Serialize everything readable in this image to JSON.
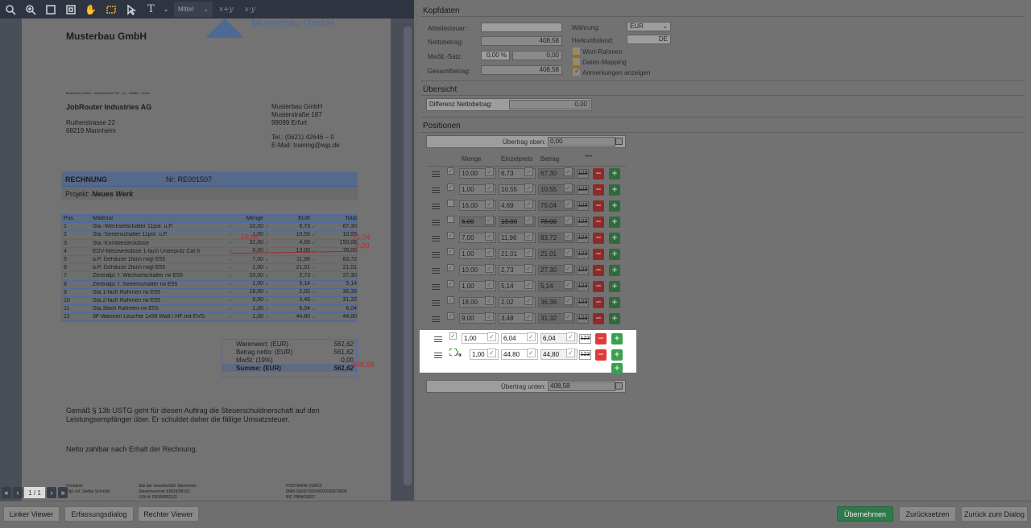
{
  "toolbar": {
    "zoom_label": "Mittel",
    "xy1": "x+y",
    "xy2": "x·y"
  },
  "pager": {
    "page": "1 / 1"
  },
  "invoice": {
    "header_company": "Musterbau GmbH",
    "logo_text": "Musterbau GmbH",
    "sender_line": "Musterbau GmbH - Musterstraße 187 – D – 99089 – Erfurt",
    "recipient": [
      "JobRouter Industries AG",
      "",
      "Rutherstrasse 22",
      "68219 Mannheim"
    ],
    "sender": [
      "Musterbau GmbH",
      "Musterstraße 187",
      "99089 Erfurt",
      "",
      "Tel.: (0621) 42646 – 0",
      "E-Mail: training@wjp.de"
    ],
    "rechnung_label": "RECHNUNG",
    "rechnung_nr": "Nr: RE001507",
    "projekt_label": "Projekt:",
    "projekt_value": "Neues Werk",
    "cols": [
      "Pos",
      "Material",
      "Menge",
      "EUR",
      "Total"
    ],
    "rows": [
      [
        "1",
        "Sta.-Wechselschalter 11pol. u.P.",
        "10,00",
        "6,73",
        "67,30"
      ],
      [
        "2",
        "Sta.-Serienschalter 11pol. u.P.",
        "1,00",
        "10,55",
        "10,55"
      ],
      [
        "3",
        "Sta.-Kombiesteckdose",
        "32,00",
        "4,69",
        "150,08"
      ],
      [
        "4",
        "EDV-Netzwerkdose 1-fach Unterputz Cat 6",
        "6,00",
        "13,00",
        "78,00"
      ],
      [
        "5",
        "a.P. Gehäuse 1fach rwgl E55",
        "7,00",
        "11,96",
        "83,72"
      ],
      [
        "6",
        "a.P. Gehäuse 2fach rwgl E55",
        "1,00",
        "21,01",
        "21,01"
      ],
      [
        "7",
        "Zentralpl. f. Wechselschalter rw E55",
        "10,00",
        "2,73",
        "27,30"
      ],
      [
        "8",
        "Zentralpl. f. Serienschalter rw E55",
        "1,00",
        "5,14",
        "5,14"
      ],
      [
        "9",
        "Sta.1-fach Rahmen rw E55",
        "18,00",
        "2,02",
        "36,36"
      ],
      [
        "10",
        "Sta.2-fach Rahmen rw E55",
        "9,00",
        "3,48",
        "31,32"
      ],
      [
        "11",
        "Sta.3fach Rahmen rw E55",
        "1,00",
        "6,04",
        "6,04"
      ],
      [
        "12",
        "3F-Wannen Leuchte 1x58 Watt / HF mit EVG",
        "1,00",
        "44,80",
        "44,80"
      ]
    ],
    "annot_16": "16,00",
    "annot_75": "75,04",
    "annot_0": "0,00",
    "annot_408": "408,58",
    "sum_rows": [
      [
        "Warenwert: (EUR)",
        "561,62"
      ],
      [
        "Betrag netto: (EUR)",
        "561,62"
      ],
      [
        "MwSt: (19%)",
        "0,00"
      ],
      [
        "Summe: (EUR)",
        "561,62"
      ]
    ],
    "footer_text1": "Gemäß § 13b USTG geht für diesen Auftrag die Steuerschuldnerschaft auf den",
    "footer_text2": "Leistungsempfänger über. Er schuldet daher die fällige Umsatzsteuer.",
    "netto_text": "Netto zahlbar nach Erhalt der Rechnung.",
    "foot_col1": [
      "Vorstand:",
      "Dipl.-Inf. Stefan Schmidt"
    ],
    "foot_col2": [
      "Sitz der Gesellschaft: Mannheim",
      "Steuernummer 93815/08152",
      "USt-Id: DE999555111"
    ],
    "foot_col3": [
      "POSTBANK (GIRO)",
      "IBAN DE02700000000030876808",
      "BIC PBNKDEFF"
    ]
  },
  "kopfdaten": {
    "title": "Kopfdaten",
    "altteilesteuer_label": "Altteilesteuer:",
    "altteilesteuer_value": "",
    "nettobetrag_label": "Nettobetrag:",
    "nettobetrag_value": "408,58",
    "mwst_label": "MwSt.-Satz:",
    "mwst_pct": "0,00 %",
    "mwst_value": "0,00",
    "gesamt_label": "Gesamtbetrag:",
    "gesamt_value": "408,58",
    "waehrung_label": "Währung:",
    "waehrung_value": "EUR",
    "herkunft_label": "Herkunftsland:",
    "herkunft_value": "DE",
    "opt_wortrahmen": "Wort-Rahmen",
    "opt_datenmapping": "Daten-Mapping",
    "opt_anmerkungen": "Anmerkungen anzeigen"
  },
  "uebersicht": {
    "title": "Übersicht",
    "diff_label": "Differenz Nettobetrag:",
    "diff_value": "0,00"
  },
  "positionen": {
    "title": "Positionen",
    "uebertrag_oben_label": "Übertrag oben:",
    "uebertrag_oben_value": "0,00",
    "col_menge": "Menge",
    "col_einzelpreis": "Einzelpreis",
    "col_betrag": "Betrag",
    "col_more": "***",
    "btn_123": "123",
    "rows": [
      {
        "menge": "10,00",
        "preis": "6,73",
        "betrag": "67,30",
        "checked": true,
        "disabled": false
      },
      {
        "menge": "1,00",
        "preis": "10,55",
        "betrag": "10,55",
        "checked": true,
        "disabled": false
      },
      {
        "menge": "16,00",
        "preis": "4,69",
        "betrag": "75,04",
        "checked": false,
        "disabled": false
      },
      {
        "menge": "6,00",
        "preis": "13,00",
        "betrag": "78,00",
        "checked": false,
        "disabled": true
      },
      {
        "menge": "7,00",
        "preis": "11,96",
        "betrag": "83,72",
        "checked": true,
        "disabled": false
      },
      {
        "menge": "1,00",
        "preis": "21,01",
        "betrag": "21,01",
        "checked": true,
        "disabled": false
      },
      {
        "menge": "10,00",
        "preis": "2,73",
        "betrag": "27,30",
        "checked": true,
        "disabled": false
      },
      {
        "menge": "1,00",
        "preis": "5,14",
        "betrag": "5,14",
        "checked": true,
        "disabled": false
      },
      {
        "menge": "18,00",
        "preis": "2,02",
        "betrag": "36,36",
        "checked": true,
        "disabled": false
      },
      {
        "menge": "9,00",
        "preis": "3,48",
        "betrag": "31,32",
        "checked": true,
        "disabled": false
      },
      {
        "menge": "1,00",
        "preis": "6,04",
        "betrag": "6,04",
        "checked": true,
        "disabled": false
      },
      {
        "menge": "1,00",
        "preis": "44,80",
        "betrag": "44,80",
        "checked": false,
        "disabled": false
      }
    ],
    "uebertrag_unten_label": "Übertrag unten:",
    "uebertrag_unten_value": "408,58"
  },
  "bottom": {
    "linker_viewer": "Linker Viewer",
    "erfassungsdialog": "Erfassungsdialog",
    "rechter_viewer": "Rechter Viewer",
    "uebernehmen": "Übernehmen",
    "zuruecksetzen": "Zurücksetzen",
    "zurueck_dialog": "Zurück zum Dialog"
  }
}
